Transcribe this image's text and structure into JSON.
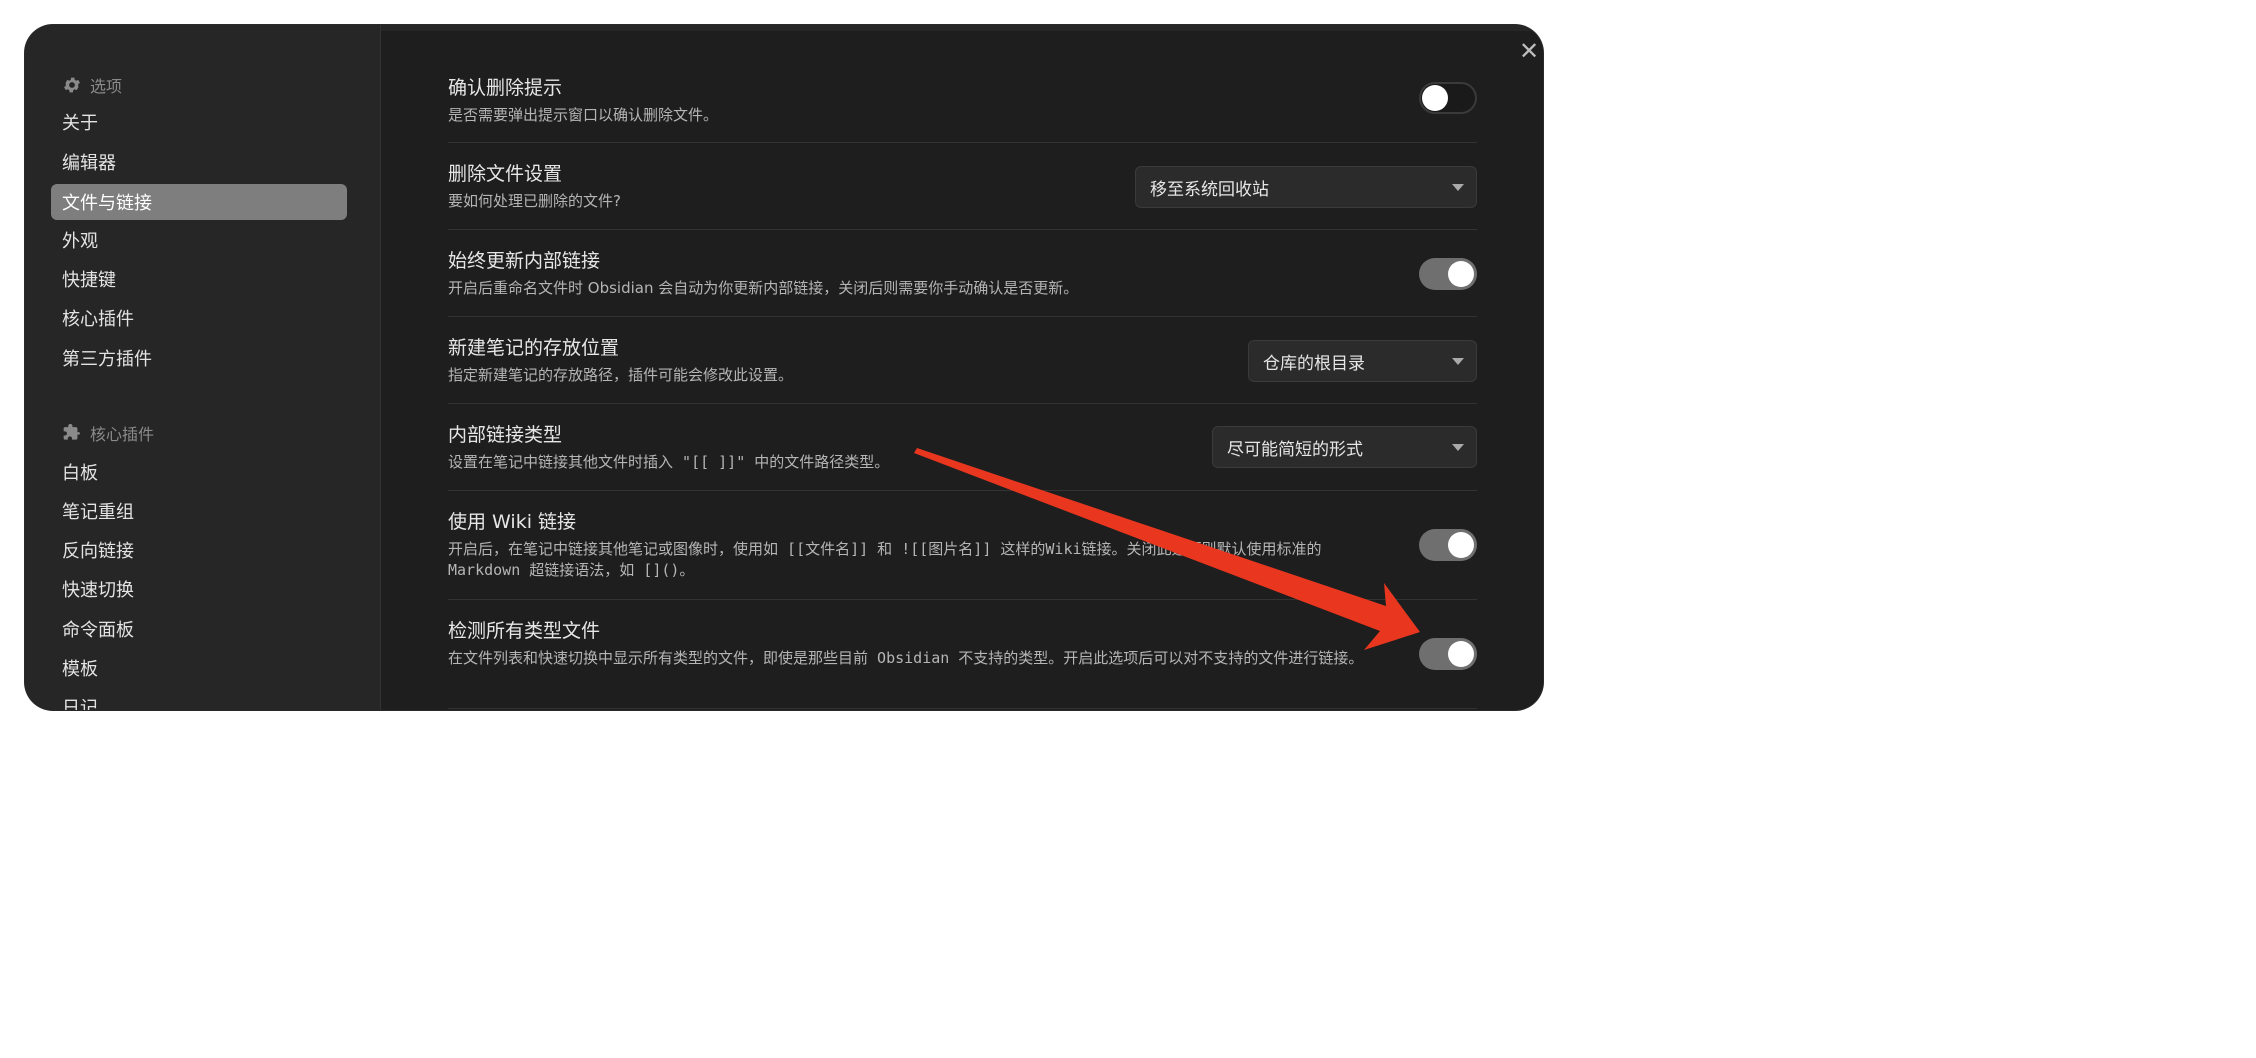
{
  "sidebar": {
    "options_heading": "选项",
    "options_items": [
      "关于",
      "编辑器",
      "文件与链接",
      "外观",
      "快捷键",
      "核心插件",
      "第三方插件"
    ],
    "active_item": "文件与链接",
    "core_plugins_heading": "核心插件",
    "core_plugin_items": [
      "白板",
      "笔记重组",
      "反向链接",
      "快速切换",
      "命令面板",
      "模板",
      "日记"
    ]
  },
  "close_label": "✕",
  "settings": [
    {
      "title": "确认删除提示",
      "desc": "是否需要弹出提示窗口以确认删除文件。",
      "control": "toggle",
      "on": false
    },
    {
      "title": "删除文件设置",
      "desc": "要如何处理已删除的文件?",
      "control": "select",
      "value": "移至系统回收站"
    },
    {
      "title": "始终更新内部链接",
      "desc": "开启后重命名文件时 Obsidian 会自动为你更新内部链接，关闭后则需要你手动确认是否更新。",
      "control": "toggle",
      "on": true
    },
    {
      "title": "新建笔记的存放位置",
      "desc": "指定新建笔记的存放路径，插件可能会修改此设置。",
      "control": "select",
      "value": "仓库的根目录"
    },
    {
      "title": "内部链接类型",
      "desc": "设置在笔记中链接其他文件时插入 \"[[ ]]\" 中的文件路径类型。",
      "control": "select",
      "value": "尽可能简短的形式"
    },
    {
      "title": "使用 Wiki 链接",
      "desc": "开启后，在笔记中链接其他笔记或图像时，使用如 [[文件名]] 和 ![[图片名]] 这样的Wiki链接。关闭此选项则默认使用标准的 Markdown 超链接语法，如 []()。",
      "control": "toggle",
      "on": true
    },
    {
      "title": "检测所有类型文件",
      "desc": "在文件列表和快速切换中显示所有类型的文件，即使是那些目前 Obsidian 不支持的类型。开启此选项后可以对不支持的文件进行链接。",
      "control": "toggle",
      "on": true
    }
  ],
  "colors": {
    "background": "#1e1e1e",
    "sidebar": "#262626",
    "active_item": "#7e7e7e",
    "annotation_arrow": "#e8361f"
  }
}
